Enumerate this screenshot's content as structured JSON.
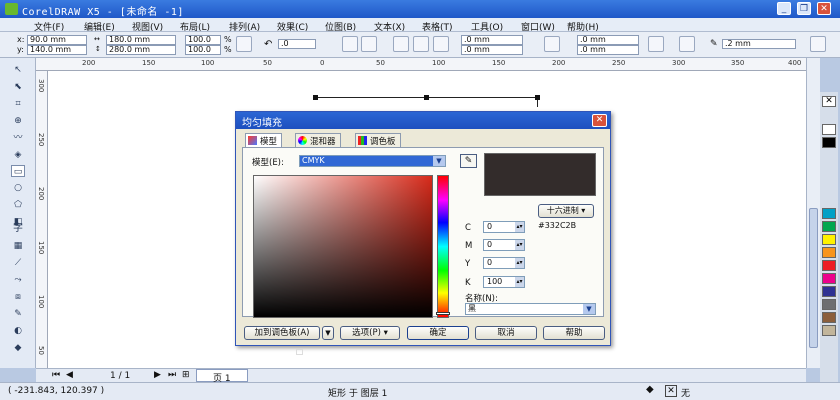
{
  "window": {
    "title": "CorelDRAW X5 - [未命名 -1]",
    "minimize": "_",
    "restore": "❐",
    "close": "✕"
  },
  "menu": [
    "文件(F)",
    "编辑(E)",
    "视图(V)",
    "布局(L)",
    "排列(A)",
    "效果(C)",
    "位图(B)",
    "文本(X)",
    "表格(T)",
    "工具(O)",
    "窗口(W)",
    "帮助(H)"
  ],
  "property_bar": {
    "x_label": "x:",
    "x_value": "90.0 mm",
    "y_label": "y:",
    "y_value": "140.0 mm",
    "width_value": "180.0 mm",
    "height_value": "280.0 mm",
    "scale_x": "100.0",
    "scale_y": "100.0",
    "percent": "%",
    "rotation": ".0",
    "corner_1": ".0 mm",
    "corner_2": ".0 mm",
    "corner_3": ".0 mm",
    "corner_4": ".0 mm",
    "outline_width": ".2 mm"
  },
  "ruler": {
    "h_ticks": [
      "200",
      "150",
      "100",
      "50",
      "0",
      "50",
      "100",
      "150",
      "200",
      "250",
      "300",
      "350",
      "400"
    ],
    "v_ticks": [
      "300",
      "250",
      "200",
      "150",
      "100",
      "50"
    ]
  },
  "dialog": {
    "title": "均匀填充",
    "close": "✕",
    "tabs": [
      "模型",
      "混和器",
      "调色板"
    ],
    "model_label": "模型(E):",
    "model_value": "CMYK",
    "hex_button": "十六进制",
    "hex_value": "#332C2B",
    "c_label": "C",
    "c_value": "0",
    "m_label": "M",
    "m_value": "0",
    "y_label": "Y",
    "y_value": "0",
    "k_label": "K",
    "k_value": "100",
    "name_label": "名称(N):",
    "name_value": "黑",
    "add_palette_button": "加到调色板(A)",
    "options_button": "选项(P)",
    "ok_button": "确定",
    "cancel_button": "取消",
    "help_button": "帮助",
    "swatch_color": "#332C2B"
  },
  "navigator": {
    "page_counter": "1 / 1",
    "page_tab": "页 1"
  },
  "status": {
    "coords": "( -231.843, 120.397 )",
    "object_info": "矩形 于 图层 1",
    "fill_none": "无"
  },
  "palette_colors": [
    "#ffffff",
    "#000000",
    "#00a0c6",
    "#00a650",
    "#fff200",
    "#f7941d",
    "#ed1c24",
    "#ec008c",
    "#2e3192",
    "#6d6e71",
    "#8b5e3c",
    "#c2b59b"
  ]
}
